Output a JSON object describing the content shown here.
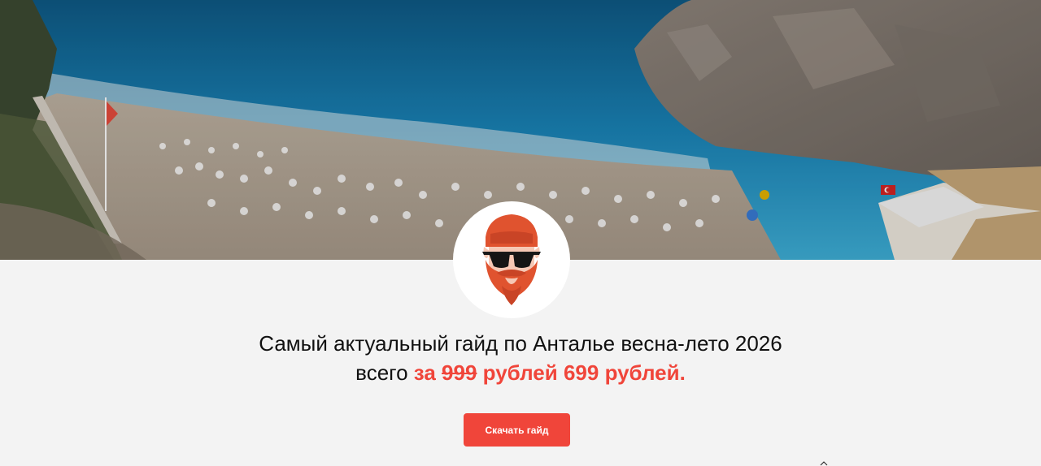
{
  "hero": {
    "image_description_icon": "beach-photo",
    "flag_icon": "turkish-flag-icon"
  },
  "avatar": {
    "icon": "bearded-man-sunglasses-icon"
  },
  "headline": "Самый актуальный гайд по Анталье весна-лето 2026",
  "price": {
    "prefix": "всего",
    "za": "за",
    "old_price": "999",
    "currency1": "рублей",
    "new_price": "699",
    "currency2": "рублей."
  },
  "cta": {
    "label": "Скачать гайд"
  },
  "colors": {
    "accent": "#f0453a",
    "background": "#f3f3f3",
    "text": "#111111"
  }
}
